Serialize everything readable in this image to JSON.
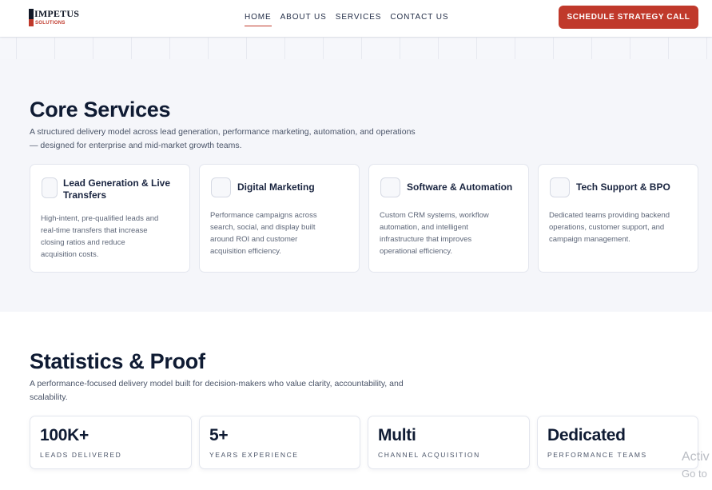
{
  "header": {
    "logo_word": "IMPETUS",
    "logo_sub": "SOLUTIONS",
    "nav": [
      {
        "label": "HOME",
        "active": true
      },
      {
        "label": "ABOUT US",
        "active": false
      },
      {
        "label": "SERVICES",
        "active": false
      },
      {
        "label": "CONTACT US",
        "active": false
      }
    ],
    "cta_label": "SCHEDULE STRATEGY CALL"
  },
  "core": {
    "title": "Core Services",
    "description_line1": "A structured delivery model across lead generation, performance marketing, automation, and operations",
    "description_line2": "— designed for enterprise and mid-market growth teams.",
    "cards": [
      {
        "title_line1": "Lead Generation & Live",
        "title_line2": "Transfers",
        "desc": [
          "High-intent, pre-qualified leads and",
          "real-time transfers that increase",
          "closing ratios and reduce",
          "acquisition costs."
        ]
      },
      {
        "title_line1": "Digital Marketing",
        "title_line2": "",
        "desc": [
          "Performance campaigns across",
          "search, social, and display built",
          "around ROI and customer",
          "acquisition efficiency."
        ]
      },
      {
        "title_line1": "Software & Automation",
        "title_line2": "",
        "desc": [
          "Custom CRM systems, workflow",
          "automation, and intelligent",
          "infrastructure that improves",
          "operational efficiency."
        ]
      },
      {
        "title_line1": "Tech Support & BPO",
        "title_line2": "",
        "desc": [
          "Dedicated teams providing backend",
          "operations, customer support, and",
          "campaign management."
        ]
      }
    ]
  },
  "stats": {
    "title": "Statistics & Proof",
    "description_line1": "A performance-focused delivery model built for decision-makers who value clarity, accountability, and",
    "description_line2": "scalability.",
    "items": [
      {
        "value": "100K+",
        "label": "LEADS DELIVERED"
      },
      {
        "value": "5+",
        "label": "YEARS EXPERIENCE"
      },
      {
        "value": "Multi",
        "label": "CHANNEL ACQUISITION"
      },
      {
        "value": "Dedicated",
        "label": "PERFORMANCE TEAMS"
      }
    ]
  },
  "watermark": {
    "line1": "Activ",
    "line2": "Go to"
  },
  "colors": {
    "accent": "#c0392b",
    "navy": "#0f1b33",
    "section_bg": "#f5f6fa"
  }
}
